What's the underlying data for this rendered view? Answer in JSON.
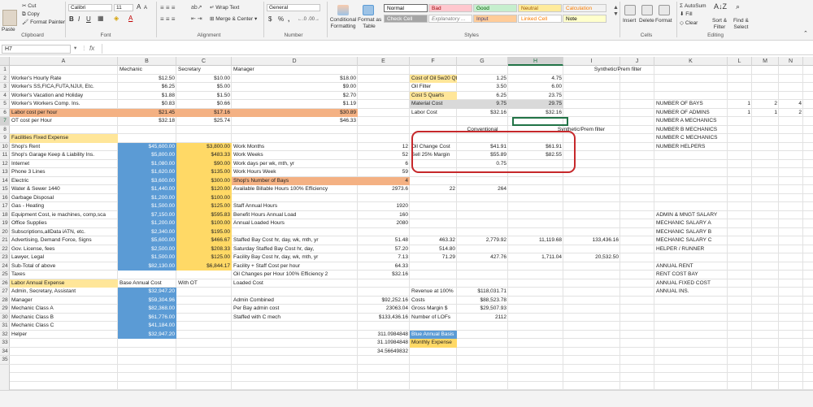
{
  "ribbon": {
    "paste": "Paste",
    "cut": "Cut",
    "copy": "Copy",
    "format_painter": "Format Painter",
    "font_name": "Calibri",
    "font_size": "11",
    "font_grow": "A",
    "font_shrink": "A",
    "bold": "B",
    "italic": "I",
    "underline": "U",
    "wrap_text": "Wrap Text",
    "merge_center": "Merge & Center",
    "number_format": "General",
    "currency": "$",
    "percent": "%",
    "comma": ",",
    "conditional_formatting": "Conditional",
    "conditional_formatting2": "Formatting",
    "format_as_table": "Format as",
    "format_as_table2": "Table",
    "insert": "Insert",
    "delete": "Delete",
    "format": "Format",
    "autosum": "AutoSum",
    "fill": "Fill",
    "clear": "Clear",
    "sort_filter": "Sort &",
    "sort_filter2": "Filter",
    "find_select": "Find &",
    "find_select2": "Select",
    "groups": {
      "clipboard": "Clipboard",
      "font": "Font",
      "alignment": "Alignment",
      "number": "Number",
      "styles": "Styles",
      "cells": "Cells",
      "editing": "Editing"
    }
  },
  "styles": [
    {
      "label": "Normal",
      "bg": "#ffffff",
      "fg": "#000000"
    },
    {
      "label": "Bad",
      "bg": "#ffc7ce",
      "fg": "#9c0006"
    },
    {
      "label": "Good",
      "bg": "#c6efce",
      "fg": "#006100"
    },
    {
      "label": "Neutral",
      "bg": "#ffeb9c",
      "fg": "#9c5700"
    },
    {
      "label": "Calculation",
      "bg": "#f2f2f2",
      "fg": "#fa7d00"
    },
    {
      "label": "Check Cell",
      "bg": "#a5a5a5",
      "fg": "#ffffff"
    },
    {
      "label": "Explanatory ...",
      "bg": "#ffffff",
      "fg": "#7f7f7f"
    },
    {
      "label": "Input",
      "bg": "#ffcc99",
      "fg": "#3f3f76"
    },
    {
      "label": "Linked Cell",
      "bg": "#ffffff",
      "fg": "#fa7d00"
    },
    {
      "label": "Note",
      "bg": "#ffffcc",
      "fg": "#000000"
    }
  ],
  "formula_bar": {
    "name_box": "H7",
    "fx": "fx",
    "value": ""
  },
  "columns": [
    "A",
    "B",
    "C",
    "D",
    "E",
    "F",
    "G",
    "H",
    "I",
    "J",
    "K",
    "L",
    "M",
    "N"
  ],
  "rows": [
    "1",
    "2",
    "3",
    "4",
    "5",
    "6",
    "7",
    "8",
    "9",
    "10",
    "11",
    "12",
    "13",
    "14",
    "15",
    "16",
    "17",
    "18",
    "19",
    "20",
    "21",
    "22",
    "23",
    "24",
    "25",
    "26",
    "27",
    "28",
    "29",
    "30",
    "31",
    "32",
    "33",
    "34",
    "35"
  ],
  "colors": {
    "blue": "#5b9bd5",
    "orange": "#f4b183",
    "gold": "#ffd966",
    "lightyellow": "#ffe699",
    "circle": "#c6282b",
    "selection": "#217346"
  },
  "cells": {
    "B1": "Mechanic",
    "C1": "Secretary",
    "D1": "Manager",
    "H1": "Synthetic/Prem filter",
    "A2": "Worker's Hourly Rate",
    "B2": "$12.50",
    "C2": "$10.00",
    "D2": "$18.00",
    "F2": "Cost of Oil 5w20 Qt.",
    "G2": "1.25",
    "H2": "4.75",
    "A3": "Worker's SS,FICA,FUTA,NJUI, Etc.",
    "B3": "$6.25",
    "C3": "$5.00",
    "D3": "$9.00",
    "F3": "Oil Filter",
    "G3": "3.50",
    "H3": "6.00",
    "A4": "Worker's Vacation and Holiday",
    "B4": "$1.88",
    "C4": "$1.50",
    "D4": "$2.70",
    "F4": "Cost 5 Quarts",
    "G4": "6.25",
    "H4": "23.75",
    "A5": "Worker's Workers Comp. Ins.",
    "B5": "$0.83",
    "C5": "$0.66",
    "D5": "$1.19",
    "F5": "Material Cost",
    "G5": "9.75",
    "H5": "29.75",
    "K5": "NUMBER OF BAYS",
    "L5": "1",
    "M5": "2",
    "N5": "4",
    "A6": "Labor cost per hour",
    "B6": "$21.45",
    "C6": "$17.16",
    "D6": "$30.89",
    "F6": "Labor Cost",
    "G6": "$32.16",
    "H6": "$32.16",
    "K6": "NUMBER OF ADMINS",
    "L6": "1",
    "M6": "1",
    "N6": "2",
    "A7": "OT cost per Hour",
    "B7": "$32.18",
    "C7": "$25.74",
    "D7": "$46.33",
    "K7": "NUMBER A MECHANICS",
    "G8": "Conventional",
    "H8": "Synthetic/Prem filter",
    "K8": "NUMBER B MECHANICS",
    "A9": "Facilities Fixed Expense",
    "K9": "NUMBER C MECHANICS",
    "A10": "Shop's Rent",
    "B10": "$45,600.00",
    "C10": "$3,800.00",
    "D10": "Work Months",
    "E10": "12",
    "F10": "Oil Change Cost",
    "G10": "$41.91",
    "H10": "$61.91",
    "K10": "NUMBER HELPERS",
    "A11": "Shop's Garage Keep & Liability Ins.",
    "B11": "$5,800.00",
    "C11": "$483.33",
    "D11": "Work Weeks",
    "E11": "52",
    "F11": "Sell 25% Margin",
    "G11": "$55.89",
    "H11": "$82.55",
    "A12": "Internet",
    "B12": "$1,080.00",
    "C12": "$90.00",
    "D12": "Work days per wk, mth, yr",
    "E12": "6",
    "G12": "0.75",
    "A13": "Phone 3 Lines",
    "B13": "$1,620.00",
    "C13": "$135.00",
    "D13": "Work Hours Week",
    "E13": "59",
    "A14": "Electric",
    "B14": "$3,600.00",
    "C14": "$300.00",
    "D14": "Shop's Number of Bays",
    "E14": "4",
    "A15": "Water & Sewer 1440",
    "B15": "$1,440.00",
    "C15": "$120.00",
    "D15": "Available Billable Hours 100% Efficiency",
    "E15": "2973.6",
    "F15": "22",
    "G15": "264",
    "A16": "Garbage Disposal",
    "B16": "$1,200.00",
    "C16": "$100.00",
    "A17": "Gas - Heating",
    "B17": "$1,500.00",
    "C17": "$125.00",
    "D17": "Staff Annual Hours",
    "E17": "1920",
    "A18": "Equipment Cost, ie machines, comp,sca",
    "B18": "$7,150.00",
    "C18": "$595.83",
    "D18": "Benefit Hours Annual Load",
    "E18": "160",
    "K18": "ADMIN & MNGT SALARY",
    "A19": "Office Supplies",
    "B19": "$1,200.00",
    "C19": "$100.00",
    "D19": "Annual Loaded Hours",
    "E19": "2080",
    "K19": "MECHANIC SALARY A",
    "A20": "Subscriptions,allData iATN, etc.",
    "B20": "$2,340.00",
    "C20": "$195.00",
    "K20": "MECHANIC SALARY B",
    "A21": "Advertising, Demand Force,  Signs",
    "B21": "$5,600.00",
    "C21": "$466.67",
    "D21": "Staffed Bay Cost hr, day, wk, mth, yr",
    "E21": "51.48",
    "F21": "463.32",
    "G21": "2,779.92",
    "H21": "11,119.68",
    "I21": "133,436.16",
    "K21": "MECHANIC SALARY C",
    "A22": "Gov. License, fees",
    "B22": "$2,500.00",
    "C22": "$208.33",
    "D22": "Saturday Staffed Bay Cost hr, day,",
    "E22": "57.20",
    "F22": "514.80",
    "K22": "HELPER / RUNNER",
    "A23": "Lawyer, Legal",
    "B23": "$1,500.00",
    "C23": "$125.00",
    "D23": "Facility Bay Cost hr, day, wk, mth, yr",
    "E23": "7.13",
    "F23": "71.29",
    "G23": "427.76",
    "H23": "1,711.04",
    "I23": "20,532.50",
    "A24": "Sub-Total of above",
    "B24": "$82,130.00",
    "C24": "$6,844.17",
    "D24": "Facility + Staff Cost per hour",
    "E24": "64.33",
    "K24": "ANNUAL RENT",
    "A25": "Taxes",
    "D25": "Oil Changes per Hour 100% Efficiency 2",
    "E25": "$32.16",
    "K25": "RENT COST BAY",
    "A26": "Labor Annual Expense",
    "B26": "Base Annual Cost",
    "C26": "With OT",
    "D26": "Loaded Cost",
    "K26": "ANNUAL FIXED COST",
    "A27": "Admin, Secretary, Assistant",
    "B27": "$32,947.20",
    "F27": "Revenue at 100%",
    "G27": "$118,031.71",
    "K27": "ANNUAL INS.",
    "A28": "Manager",
    "B28": "$59,304.96",
    "E28": "$92,252.16",
    "F28": "Costs",
    "G28": "$88,523.78",
    "D28": "Admin Combined",
    "A29": "Mechanic Class A",
    "B29": "$82,368.00",
    "D29": "Per Bay admin cost",
    "E29": "23063.04",
    "F29": "Gross Margin $",
    "G29": "$29,507.93",
    "A30": "Mechanic Class B",
    "B30": "$61,776.00",
    "D30": "Staffed with C mech",
    "E30": "$133,436.16",
    "F30": "Number of LOFs",
    "G30": "2112",
    "A31": "Mechanic Class C",
    "B31": "$41,184.00",
    "A32": "Helper",
    "B32": "$32,947.20",
    "E32": "311.0984848",
    "F32": "Blue Annual Basis",
    "E33": "31.10984848",
    "F33": "Monthly Expense",
    "E34": "34.56649832"
  }
}
